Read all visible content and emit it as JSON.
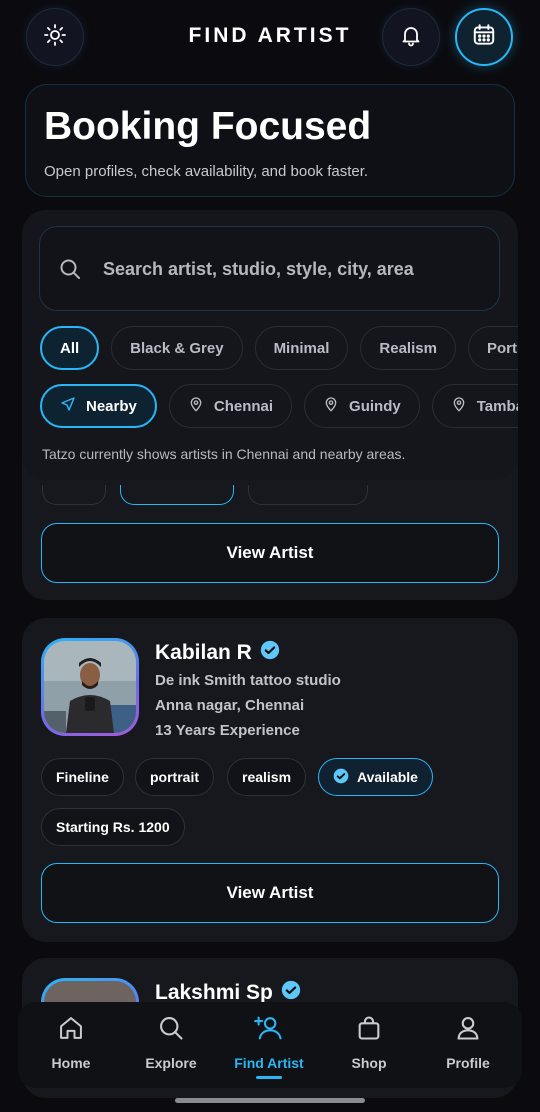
{
  "header": {
    "title": "FIND ARTIST",
    "left_icon": "sun-icon",
    "right_icons": [
      "bell-icon",
      "calendar-icon"
    ]
  },
  "hero": {
    "title": "Booking Focused",
    "subtitle": "Open profiles, check availability, and book faster."
  },
  "search": {
    "placeholder": "Search artist, studio, style, city, area",
    "style_chips": [
      {
        "label": "All",
        "active": true
      },
      {
        "label": "Black & Grey",
        "active": false
      },
      {
        "label": "Minimal",
        "active": false
      },
      {
        "label": "Realism",
        "active": false
      },
      {
        "label": "Portrait",
        "active": false
      }
    ],
    "location_chips": [
      {
        "label": "Nearby",
        "icon": "navigation-arrow-icon",
        "active": true
      },
      {
        "label": "Chennai",
        "icon": "map-pin-icon",
        "active": false
      },
      {
        "label": "Guindy",
        "icon": "map-pin-icon",
        "active": false
      },
      {
        "label": "Tambaram",
        "icon": "map-pin-icon",
        "active": false
      }
    ],
    "note": "Tatzo currently shows artists in Chennai and nearby areas."
  },
  "artists": [
    {
      "view_label": "View Artist"
    },
    {
      "name": "Kabilan R",
      "verified": true,
      "studio": "De ink Smith tattoo studio",
      "location": "Anna nagar, Chennai",
      "experience": "13 Years Experience",
      "tags": [
        "Fineline",
        "portrait",
        "realism"
      ],
      "availability": "Available",
      "price": "Starting Rs. 1200",
      "view_label": "View Artist"
    },
    {
      "name": "Lakshmi Sp",
      "verified": true
    }
  ],
  "nav": {
    "items": [
      {
        "label": "Home",
        "icon": "home-icon",
        "active": false
      },
      {
        "label": "Explore",
        "icon": "search-icon",
        "active": false
      },
      {
        "label": "Find Artist",
        "icon": "user-plus-icon",
        "active": true
      },
      {
        "label": "Shop",
        "icon": "shopping-bag-icon",
        "active": false
      },
      {
        "label": "Profile",
        "icon": "user-icon",
        "active": false
      }
    ]
  },
  "colors": {
    "accent": "#29b6f6",
    "background": "#0b0b0f",
    "card": "#17181d"
  }
}
